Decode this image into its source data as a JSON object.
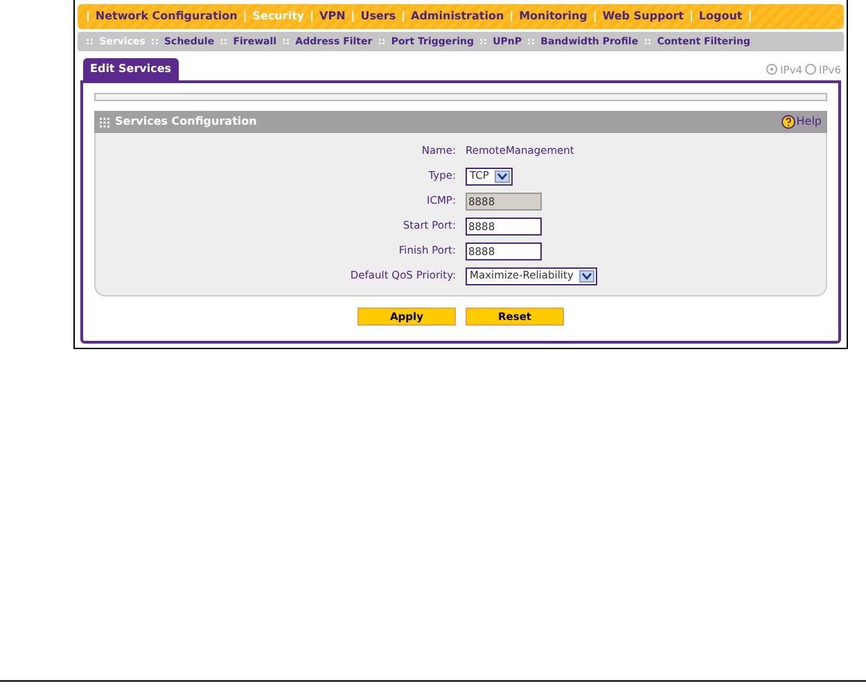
{
  "top_nav": [
    {
      "kind": "separator",
      "label": "|"
    },
    {
      "kind": "link",
      "label": "Network Configuration",
      "selected": false
    },
    {
      "kind": "separator",
      "label": "|"
    },
    {
      "kind": "link",
      "label": "Security",
      "selected": true
    },
    {
      "kind": "separator",
      "label": "|"
    },
    {
      "kind": "link",
      "label": "VPN",
      "selected": false
    },
    {
      "kind": "separator",
      "label": "|"
    },
    {
      "kind": "link",
      "label": "Users",
      "selected": false
    },
    {
      "kind": "separator",
      "label": "|"
    },
    {
      "kind": "link",
      "label": "Administration",
      "selected": false
    },
    {
      "kind": "separator",
      "label": "|"
    },
    {
      "kind": "link",
      "label": "Monitoring",
      "selected": false
    },
    {
      "kind": "separator",
      "label": "|"
    },
    {
      "kind": "link",
      "label": "Web Support",
      "selected": false
    },
    {
      "kind": "separator",
      "label": "|"
    },
    {
      "kind": "link",
      "label": "Logout",
      "selected": false
    },
    {
      "kind": "separator",
      "label": "|"
    }
  ],
  "sub_nav": [
    {
      "kind": "separator",
      "label": "::"
    },
    {
      "kind": "link",
      "label": "Services",
      "selected": true
    },
    {
      "kind": "separator",
      "label": "::"
    },
    {
      "kind": "link",
      "label": "Schedule",
      "selected": false
    },
    {
      "kind": "separator",
      "label": "::"
    },
    {
      "kind": "link",
      "label": "Firewall",
      "selected": false
    },
    {
      "kind": "separator",
      "label": "::"
    },
    {
      "kind": "link",
      "label": "Address Filter",
      "selected": false
    },
    {
      "kind": "separator",
      "label": "::"
    },
    {
      "kind": "link",
      "label": "Port Triggering",
      "selected": false
    },
    {
      "kind": "separator",
      "label": "::"
    },
    {
      "kind": "link",
      "label": "UPnP",
      "selected": false
    },
    {
      "kind": "separator",
      "label": "::"
    },
    {
      "kind": "link",
      "label": "Bandwidth Profile",
      "selected": false
    },
    {
      "kind": "separator",
      "label": "::"
    },
    {
      "kind": "link",
      "label": "Content Filtering",
      "selected": false
    }
  ],
  "tab": {
    "label": "Edit Services"
  },
  "ip_versions": [
    {
      "label": "IPv4",
      "selected": true
    },
    {
      "label": "IPv6",
      "selected": false
    }
  ],
  "section": {
    "title": "Services Configuration",
    "help": "Help"
  },
  "fields": [
    {
      "label": "Name:",
      "kind": "text",
      "value": "RemoteManagement"
    },
    {
      "label": "Type:",
      "kind": "select",
      "value": "TCP"
    },
    {
      "label": "ICMP:",
      "kind": "input",
      "value": "8888",
      "disabled": true
    },
    {
      "label": "Start Port:",
      "kind": "input",
      "value": "8888",
      "disabled": false
    },
    {
      "label": "Finish Port:",
      "kind": "input",
      "value": "8888",
      "disabled": false
    },
    {
      "label": "Default QoS Priority:",
      "kind": "select",
      "value": "Maximize-Reliability"
    }
  ],
  "buttons": [
    "Apply",
    "Reset"
  ]
}
